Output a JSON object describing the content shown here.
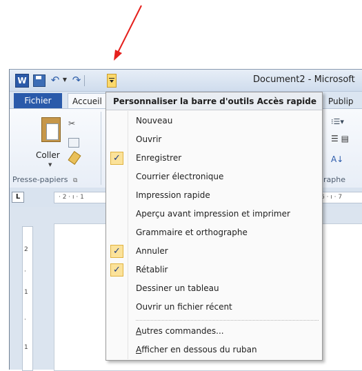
{
  "window": {
    "title": "Document2 - Microsoft",
    "word_icon_letter": "W"
  },
  "ribbon": {
    "tabs": {
      "file": "Fichier",
      "home": "Accueil",
      "partial_right": "Publip"
    },
    "paste_label": "Coller",
    "group_clipboard": "Presse-papiers",
    "group_partial_right": "graphe"
  },
  "ruler": {
    "left_marks": "· 2 · ı · 1",
    "right_marks": "6 · ı · 7"
  },
  "menu": {
    "header": "Personnaliser la barre d'outils Accès rapide",
    "check_glyph": "✓",
    "items": [
      {
        "label": "Nouveau",
        "checked": false
      },
      {
        "label": "Ouvrir",
        "checked": false
      },
      {
        "label": "Enregistrer",
        "checked": true
      },
      {
        "label": "Courrier électronique",
        "checked": false
      },
      {
        "label": "Impression rapide",
        "checked": false
      },
      {
        "label": "Aperçu avant impression et imprimer",
        "checked": false
      },
      {
        "label": "Grammaire et orthographe",
        "checked": false
      },
      {
        "label": "Annuler",
        "checked": true
      },
      {
        "label": "Rétablir",
        "checked": true
      },
      {
        "label": "Dessiner un tableau",
        "checked": false
      },
      {
        "label": "Ouvrir un fichier récent",
        "checked": false
      }
    ],
    "more_commands": {
      "underlined": "A",
      "rest": "utres commandes..."
    },
    "show_below": {
      "underlined": "A",
      "rest": "fficher en dessous du ruban"
    }
  },
  "colors": {
    "annotation_arrow": "#e5201d",
    "file_tab": "#2a5aaa",
    "check_highlight": "#fbe29a"
  }
}
